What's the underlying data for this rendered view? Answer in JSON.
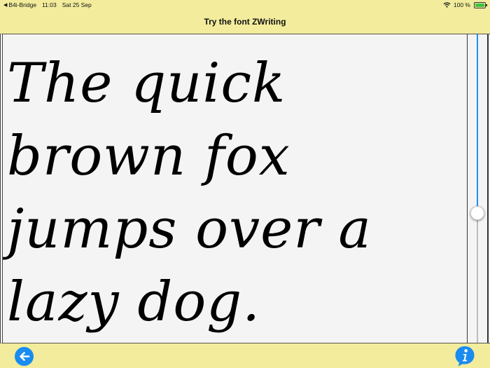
{
  "status_bar": {
    "back_app": "B4i-Bridge",
    "time": "11:03",
    "date": "Sat 25 Sep",
    "battery_percent": "100 %"
  },
  "title": "Try the font ZWriting",
  "sample_text": "The quick brown fox jumps over a lazy dog.",
  "slider": {
    "value": 0.58
  },
  "icons": {
    "back": "arrow-left-icon",
    "info": "info-speech-bubble-icon",
    "wifi": "wifi-icon",
    "battery": "battery-charging-icon"
  },
  "colors": {
    "background": "#f2ec9c",
    "accent": "#1a8cf0",
    "text_area": "#f4f4f4"
  }
}
